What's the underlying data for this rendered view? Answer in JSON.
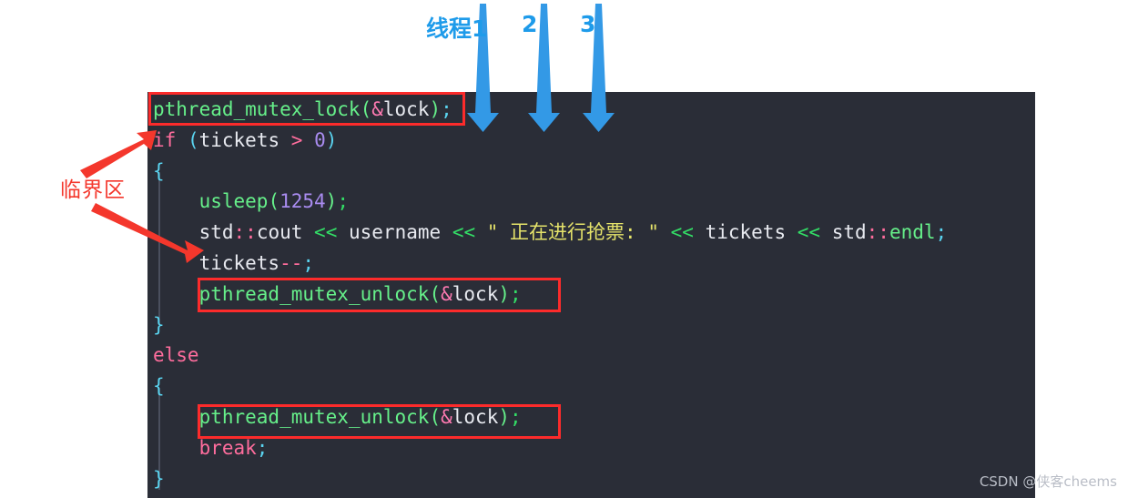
{
  "editor": {
    "background": "#2a2d37",
    "lines": [
      "pthread_mutex_lock(&lock);",
      "if (tickets > 0)",
      "{",
      "    usleep(1254);",
      "    std::cout << username << \" 正在进行抢票: \" << tickets << std::endl;",
      "    tickets--;",
      "    pthread_mutex_unlock(&lock);",
      "}",
      "else",
      "{",
      "    pthread_mutex_unlock(&lock);",
      "    break;",
      "}"
    ],
    "tokens": {
      "line1": [
        "pthread_mutex_lock",
        "(",
        "&",
        "lock",
        ")",
        ";"
      ],
      "line2": [
        "if",
        " (",
        "tickets",
        " > ",
        "0",
        ")"
      ],
      "line4": [
        "usleep",
        "(",
        "1254",
        ")",
        ";"
      ],
      "line5": [
        "std",
        "::",
        "cout",
        " << ",
        "username",
        " << ",
        "\" 正在进行抢票: \"",
        " << ",
        "tickets",
        " << ",
        "std",
        "::",
        "endl",
        ";"
      ],
      "line6": [
        "tickets",
        "--",
        ";"
      ],
      "line7": [
        "pthread_mutex_unlock",
        "(",
        "&",
        "lock",
        ")",
        ";"
      ],
      "line9": [
        "else"
      ],
      "line11": [
        "pthread_mutex_unlock",
        "(",
        "&",
        "lock",
        ")",
        ";"
      ],
      "line12": [
        "break",
        ";"
      ]
    },
    "string_literal": "\" 正在进行抢票: \"",
    "number_literal": "1254"
  },
  "annotations": {
    "thread_labels": [
      {
        "text": "线程1",
        "color": "#1e9bea"
      },
      {
        "text": "2",
        "color": "#1e9bea"
      },
      {
        "text": "3",
        "color": "#1e9bea"
      }
    ],
    "critical_section_label": "临界区",
    "arrow_color_blue": "#3399e6",
    "arrow_color_red": "#f4372c",
    "highlight_box_color": "#fc2b2b"
  },
  "watermark": {
    "text": "CSDN @侠客cheems"
  }
}
